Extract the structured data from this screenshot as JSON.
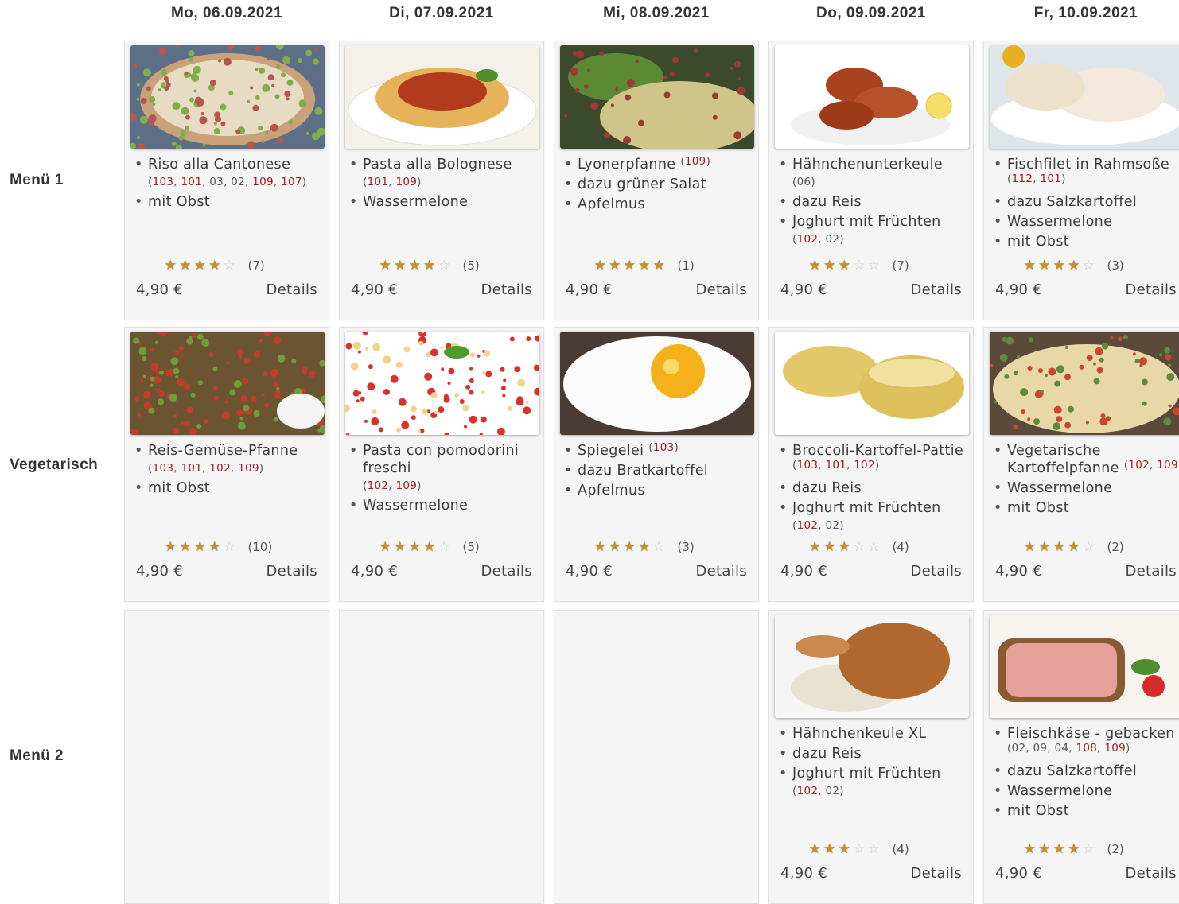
{
  "days": [
    "Mo, 06.09.2021",
    "Di, 07.09.2021",
    "Mi, 08.09.2021",
    "Do, 09.09.2021",
    "Fr, 10.09.2021"
  ],
  "rows": [
    "Menü 1",
    "Vegetarisch",
    "Menü 2"
  ],
  "cards": [
    {
      "row": 0,
      "col": 0,
      "image": "rice-bowl-photo",
      "items": [
        {
          "text": "Riso alla Cantonese",
          "allergens": [
            {
              "c": "103",
              "red": true
            },
            {
              "c": "101",
              "red": true
            },
            {
              "c": "03",
              "red": false
            },
            {
              "c": "02",
              "red": false
            },
            {
              "c": "109",
              "red": true
            },
            {
              "c": "107",
              "red": true
            }
          ],
          "inline": false
        },
        {
          "text": "mit Obst"
        }
      ],
      "rating": 4,
      "votes": "(7)",
      "price": "4,90 €",
      "details": "Details"
    },
    {
      "row": 0,
      "col": 1,
      "image": "pasta-bolognese-photo",
      "items": [
        {
          "text": "Pasta alla Bolognese",
          "allergens": [
            {
              "c": "101",
              "red": true
            },
            {
              "c": "109",
              "red": true
            }
          ],
          "inline": false
        },
        {
          "text": "Wassermelone"
        }
      ],
      "rating": 4.5,
      "votes": "(5)",
      "price": "4,90 €",
      "details": "Details"
    },
    {
      "row": 0,
      "col": 2,
      "image": "lyoner-pan-photo",
      "items": [
        {
          "text": "Lyonerpfanne",
          "allergens": [
            {
              "c": "109",
              "red": true
            }
          ],
          "inline": true
        },
        {
          "text": "dazu grüner Salat"
        },
        {
          "text": "Apfelmus"
        }
      ],
      "rating": 5,
      "votes": "(1)",
      "price": "4,90 €",
      "details": "Details"
    },
    {
      "row": 0,
      "col": 3,
      "image": "chicken-legs-photo",
      "items": [
        {
          "text": "Hähnchenunterkeule",
          "allergens": [
            {
              "c": "06",
              "red": false
            }
          ],
          "inline": false
        },
        {
          "text": "dazu Reis"
        },
        {
          "text": "Joghurt mit Früchten",
          "allergens": [
            {
              "c": "102",
              "red": true
            },
            {
              "c": "02",
              "red": false
            }
          ],
          "inline": false
        }
      ],
      "rating": 3,
      "votes": "(7)",
      "price": "4,90 €",
      "details": "Details"
    },
    {
      "row": 0,
      "col": 4,
      "image": "fish-fillet-photo",
      "items": [
        {
          "text": "Fischfilet in Rahmsoße",
          "allergens": [
            {
              "c": "112",
              "red": true
            },
            {
              "c": "101",
              "red": true
            }
          ],
          "inline": true
        },
        {
          "text": "dazu Salzkartoffel"
        },
        {
          "text": "Wassermelone"
        },
        {
          "text": "mit Obst"
        }
      ],
      "rating": 4.5,
      "votes": "(3)",
      "price": "4,90 €",
      "details": "Details"
    },
    {
      "row": 1,
      "col": 0,
      "image": "veg-rice-pan-photo",
      "items": [
        {
          "text": "Reis-Gemüse-Pfanne",
          "allergens": [
            {
              "c": "103",
              "red": true
            },
            {
              "c": "101",
              "red": true
            },
            {
              "c": "102",
              "red": true
            },
            {
              "c": "109",
              "red": true
            }
          ],
          "inline": false
        },
        {
          "text": "mit Obst"
        }
      ],
      "rating": 4,
      "votes": "(10)",
      "price": "4,90 €",
      "details": "Details"
    },
    {
      "row": 1,
      "col": 1,
      "image": "pasta-tomato-photo",
      "items": [
        {
          "text": "Pasta con pomodorini freschi",
          "allergens": [
            {
              "c": "102",
              "red": true
            },
            {
              "c": "109",
              "red": true
            }
          ],
          "inline": false
        },
        {
          "text": "Wassermelone"
        }
      ],
      "rating": 4.5,
      "votes": "(5)",
      "price": "4,90 €",
      "details": "Details"
    },
    {
      "row": 1,
      "col": 2,
      "image": "fried-egg-photo",
      "items": [
        {
          "text": "Spiegelei",
          "allergens": [
            {
              "c": "103",
              "red": true
            }
          ],
          "inline": true
        },
        {
          "text": "dazu Bratkartoffel"
        },
        {
          "text": "Apfelmus"
        }
      ],
      "rating": 4,
      "votes": "(3)",
      "price": "4,90 €",
      "details": "Details"
    },
    {
      "row": 1,
      "col": 3,
      "image": "broccoli-pattie-photo",
      "items": [
        {
          "text": "Broccoli-Kartoffel-Pattie",
          "allergens": [
            {
              "c": "103",
              "red": true
            },
            {
              "c": "101",
              "red": true
            },
            {
              "c": "102",
              "red": true
            }
          ],
          "inline": true
        },
        {
          "text": "dazu Reis"
        },
        {
          "text": "Joghurt mit Früchten",
          "allergens": [
            {
              "c": "102",
              "red": true
            },
            {
              "c": "02",
              "red": false
            }
          ],
          "inline": false
        }
      ],
      "rating": 3,
      "votes": "(4)",
      "price": "4,90 €",
      "details": "Details"
    },
    {
      "row": 1,
      "col": 4,
      "image": "veg-potato-pan-photo",
      "items": [
        {
          "text": "Vegetarische Kartoffelpfanne",
          "allergens": [
            {
              "c": "102",
              "red": true
            },
            {
              "c": "109",
              "red": true
            }
          ],
          "inline": true
        },
        {
          "text": "Wassermelone"
        },
        {
          "text": "mit Obst"
        }
      ],
      "rating": 4,
      "votes": "(2)",
      "price": "4,90 €",
      "details": "Details"
    },
    {
      "row": 2,
      "col": 0,
      "empty": true
    },
    {
      "row": 2,
      "col": 1,
      "empty": true
    },
    {
      "row": 2,
      "col": 2,
      "empty": true
    },
    {
      "row": 2,
      "col": 3,
      "image": "chicken-leg-xl-photo",
      "items": [
        {
          "text": "Hähnchenkeule XL"
        },
        {
          "text": "dazu Reis"
        },
        {
          "text": "Joghurt mit Früchten",
          "allergens": [
            {
              "c": "102",
              "red": true
            },
            {
              "c": "02",
              "red": false
            }
          ],
          "inline": false
        }
      ],
      "rating": 3,
      "votes": "(4)",
      "price": "4,90 €",
      "details": "Details"
    },
    {
      "row": 2,
      "col": 4,
      "image": "fleischkaese-photo",
      "items": [
        {
          "text": "Fleischkäse - gebacken",
          "allergens": [
            {
              "c": "02",
              "red": false
            },
            {
              "c": "09",
              "red": false
            },
            {
              "c": "04",
              "red": false
            },
            {
              "c": "108",
              "red": true
            },
            {
              "c": "109",
              "red": true
            }
          ],
          "inline": true
        },
        {
          "text": "dazu Salzkartoffel"
        },
        {
          "text": "Wassermelone"
        },
        {
          "text": "mit Obst"
        }
      ],
      "rating": 4,
      "votes": "(2)",
      "price": "4,90 €",
      "details": "Details"
    }
  ]
}
